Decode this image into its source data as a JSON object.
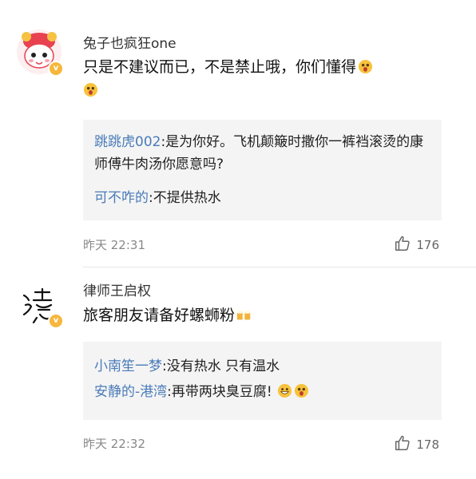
{
  "comments": [
    {
      "username": "兔子也疯狂one",
      "text": "只是不建议而已，不是禁止哦，你们懂得",
      "replies": [
        {
          "user": "跳跳虎002",
          "text": ":是为你好。飞机颠簸时撒你一裤裆滚烫的康师傅牛肉汤你愿意吗?"
        },
        {
          "user": "可不咋的",
          "text": ":不提供热水"
        }
      ],
      "time": "昨天 22:31",
      "likes": "176",
      "avatar_icon": "cartoon-girl-avatar"
    },
    {
      "username": "律师王启权",
      "text": "旅客朋友请备好螺蛳粉",
      "replies": [
        {
          "user": "小南笙一梦",
          "text": ":没有热水 只有温水"
        },
        {
          "user": "安静的-港湾",
          "text": ":再带两块臭豆腐!"
        }
      ],
      "time": "昨天 22:32",
      "likes": "178",
      "avatar_icon": "calligraphy-avatar",
      "avatar_text": "濾"
    }
  ]
}
